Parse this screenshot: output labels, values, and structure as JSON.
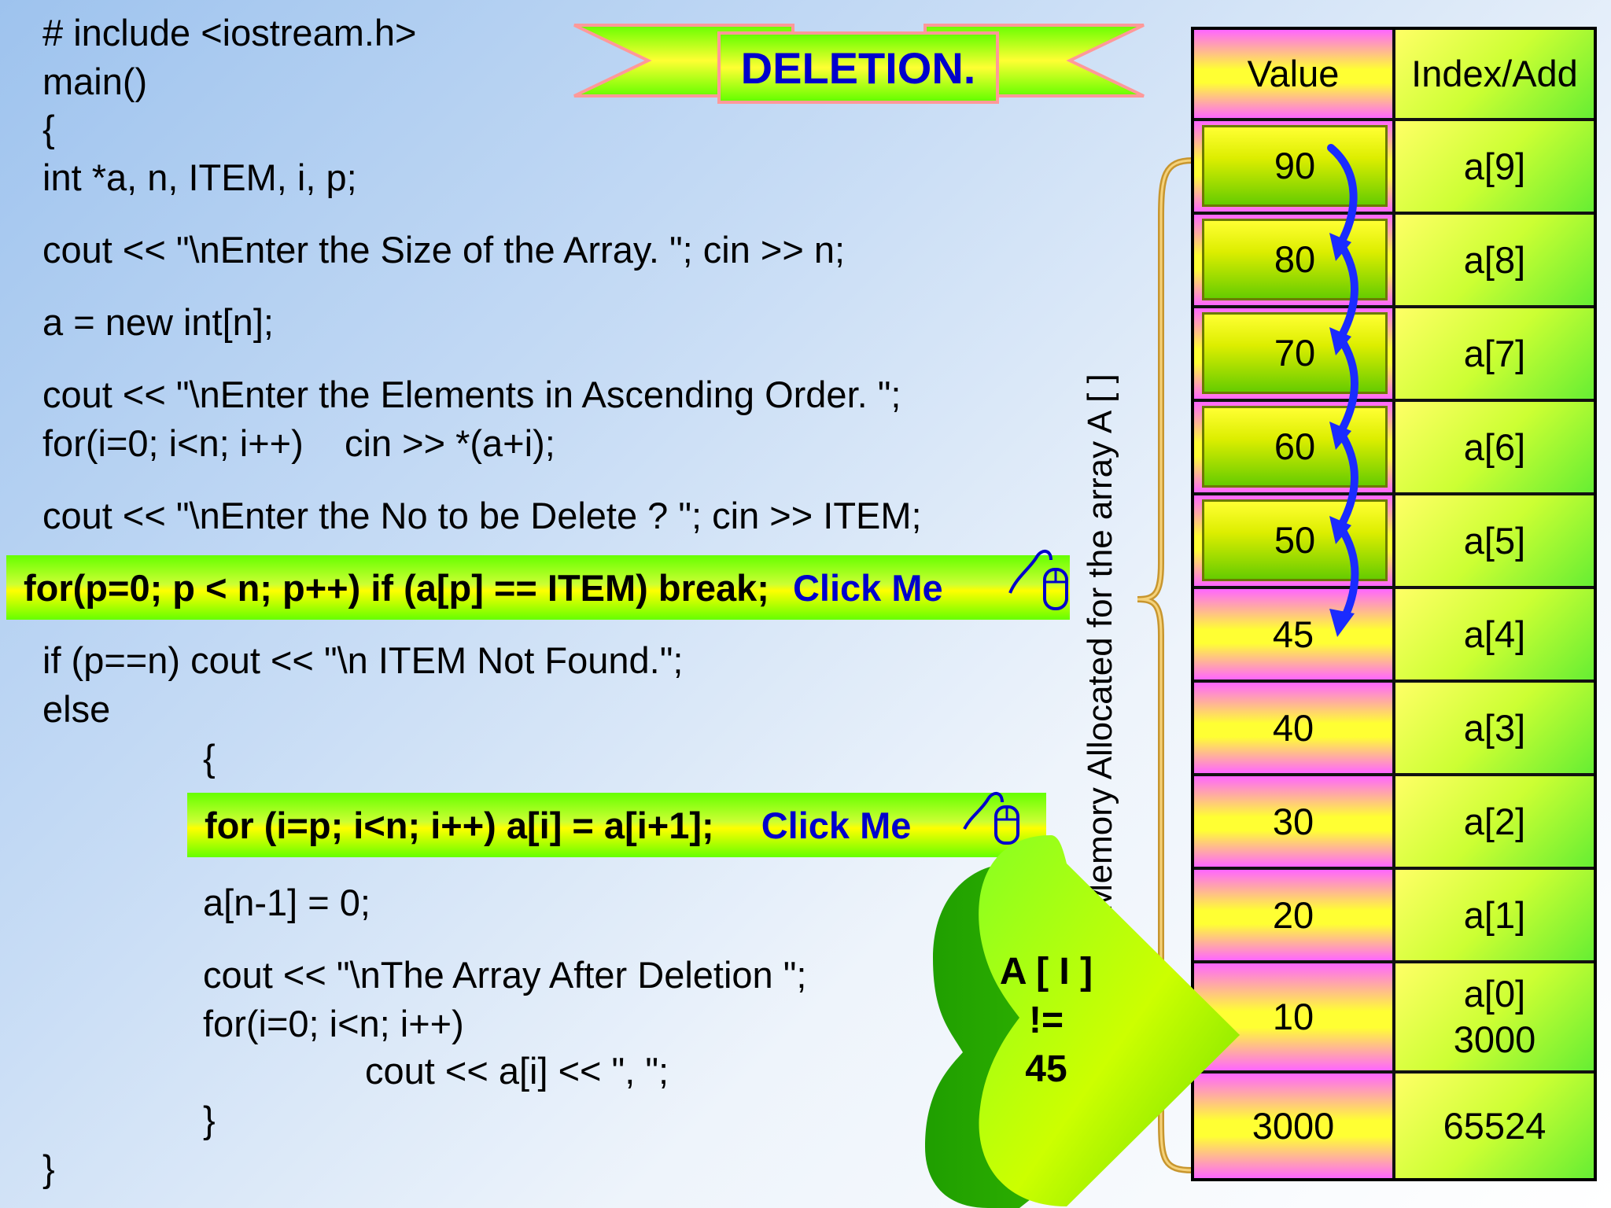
{
  "title": "DELETION.",
  "code": {
    "line_include": "# include <iostream.h>",
    "line_main": "main()",
    "line_open": "{",
    "line_decl": "int *a, n, ITEM, i, p;",
    "line_size": "cout << \"\\nEnter the Size of the Array. \"; cin >> n;",
    "line_new": "a = new int[n];",
    "line_enter": "cout << \"\\nEnter the Elements in Ascending Order. \";",
    "line_for_in": "for(i=0; i<n; i++)    cin >> *(a+i);",
    "line_item": "cout << \"\\nEnter the No to be Delete ? \"; cin >> ITEM;",
    "line_search": "for(p=0; p < n; p++) if (a[p] == ITEM) break;",
    "line_ifp": "if (p==n) cout << \"\\n ITEM Not Found.\";",
    "line_else": "else",
    "line_inner_open": "{",
    "line_shift": "for (i=p; i<n; i++) a[i] = a[i+1];",
    "line_zero": "a[n-1] = 0;",
    "line_after": "cout << \"\\nThe Array After Deletion \";",
    "line_for_out": "for(i=0; i<n; i++)",
    "line_cout": "cout << a[i] << \", \";",
    "line_inner_close": "}",
    "line_close": "}"
  },
  "buttons": {
    "click_me_1": "Click Me",
    "click_me_2": "Click Me"
  },
  "memory_label": "Memory Allocated for the array A [ ]",
  "heart": {
    "line1": "A [ I ]",
    "line2": "!=",
    "line3": "45"
  },
  "table": {
    "header_value": "Value",
    "header_index": "Index/Add",
    "rows": [
      {
        "value": "90",
        "index": "a[9]"
      },
      {
        "value": "80",
        "index": "a[8]"
      },
      {
        "value": "70",
        "index": "a[7]"
      },
      {
        "value": "60",
        "index": "a[6]"
      },
      {
        "value": "50",
        "index": "a[5]"
      },
      {
        "value": "45",
        "index": "a[4]"
      },
      {
        "value": "40",
        "index": "a[3]"
      },
      {
        "value": "30",
        "index": "a[2]"
      },
      {
        "value": "20",
        "index": "a[1]"
      },
      {
        "value": "10",
        "index": "a[0]",
        "index2": "3000"
      },
      {
        "value": "3000",
        "index": "65524"
      }
    ]
  },
  "colors": {
    "accent_blue": "#0000cc",
    "arrow_blue": "#1a2bff",
    "highlight_green": "#66ff00",
    "highlight_yellow": "#ffff00",
    "value_pink": "#ff66ff"
  }
}
